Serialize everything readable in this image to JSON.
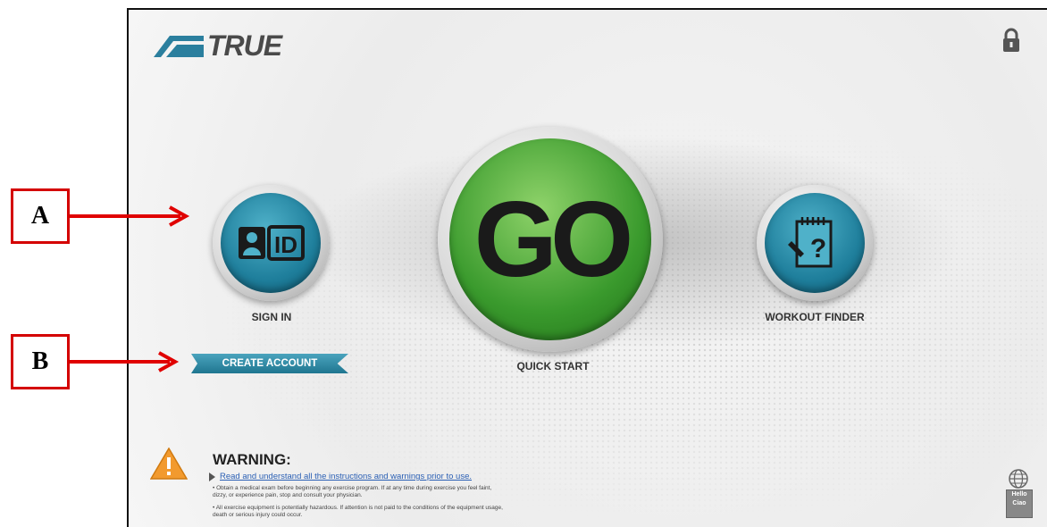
{
  "brand": {
    "logo_text": "TRUE"
  },
  "buttons": {
    "signin": {
      "label": "SIGN IN",
      "icon_text": "ID"
    },
    "go": {
      "label": "QUICK START",
      "icon_text": "GO"
    },
    "workout": {
      "label": "WORKOUT FINDER",
      "icon_text": "?"
    },
    "create_account": {
      "label": "CREATE ACCOUNT"
    }
  },
  "warning": {
    "title": "WARNING:",
    "link": "Read and understand all the instructions and warnings prior to use.",
    "bullets": [
      "• Obtain a medical exam before beginning any exercise program. If at any time during exercise you feel faint, dizzy, or experience pain, stop and consult your physician.",
      "• All exercise equipment is potentially hazardous. If attention is not paid to the conditions of the equipment usage, death or serious injury could occur."
    ]
  },
  "language": {
    "line1": "Hello",
    "line2": "Ciao"
  },
  "callouts": {
    "a": "A",
    "b": "B"
  },
  "colors": {
    "teal": "#1f7f9c",
    "green": "#3a9a2d",
    "callout_red": "#d40000"
  }
}
